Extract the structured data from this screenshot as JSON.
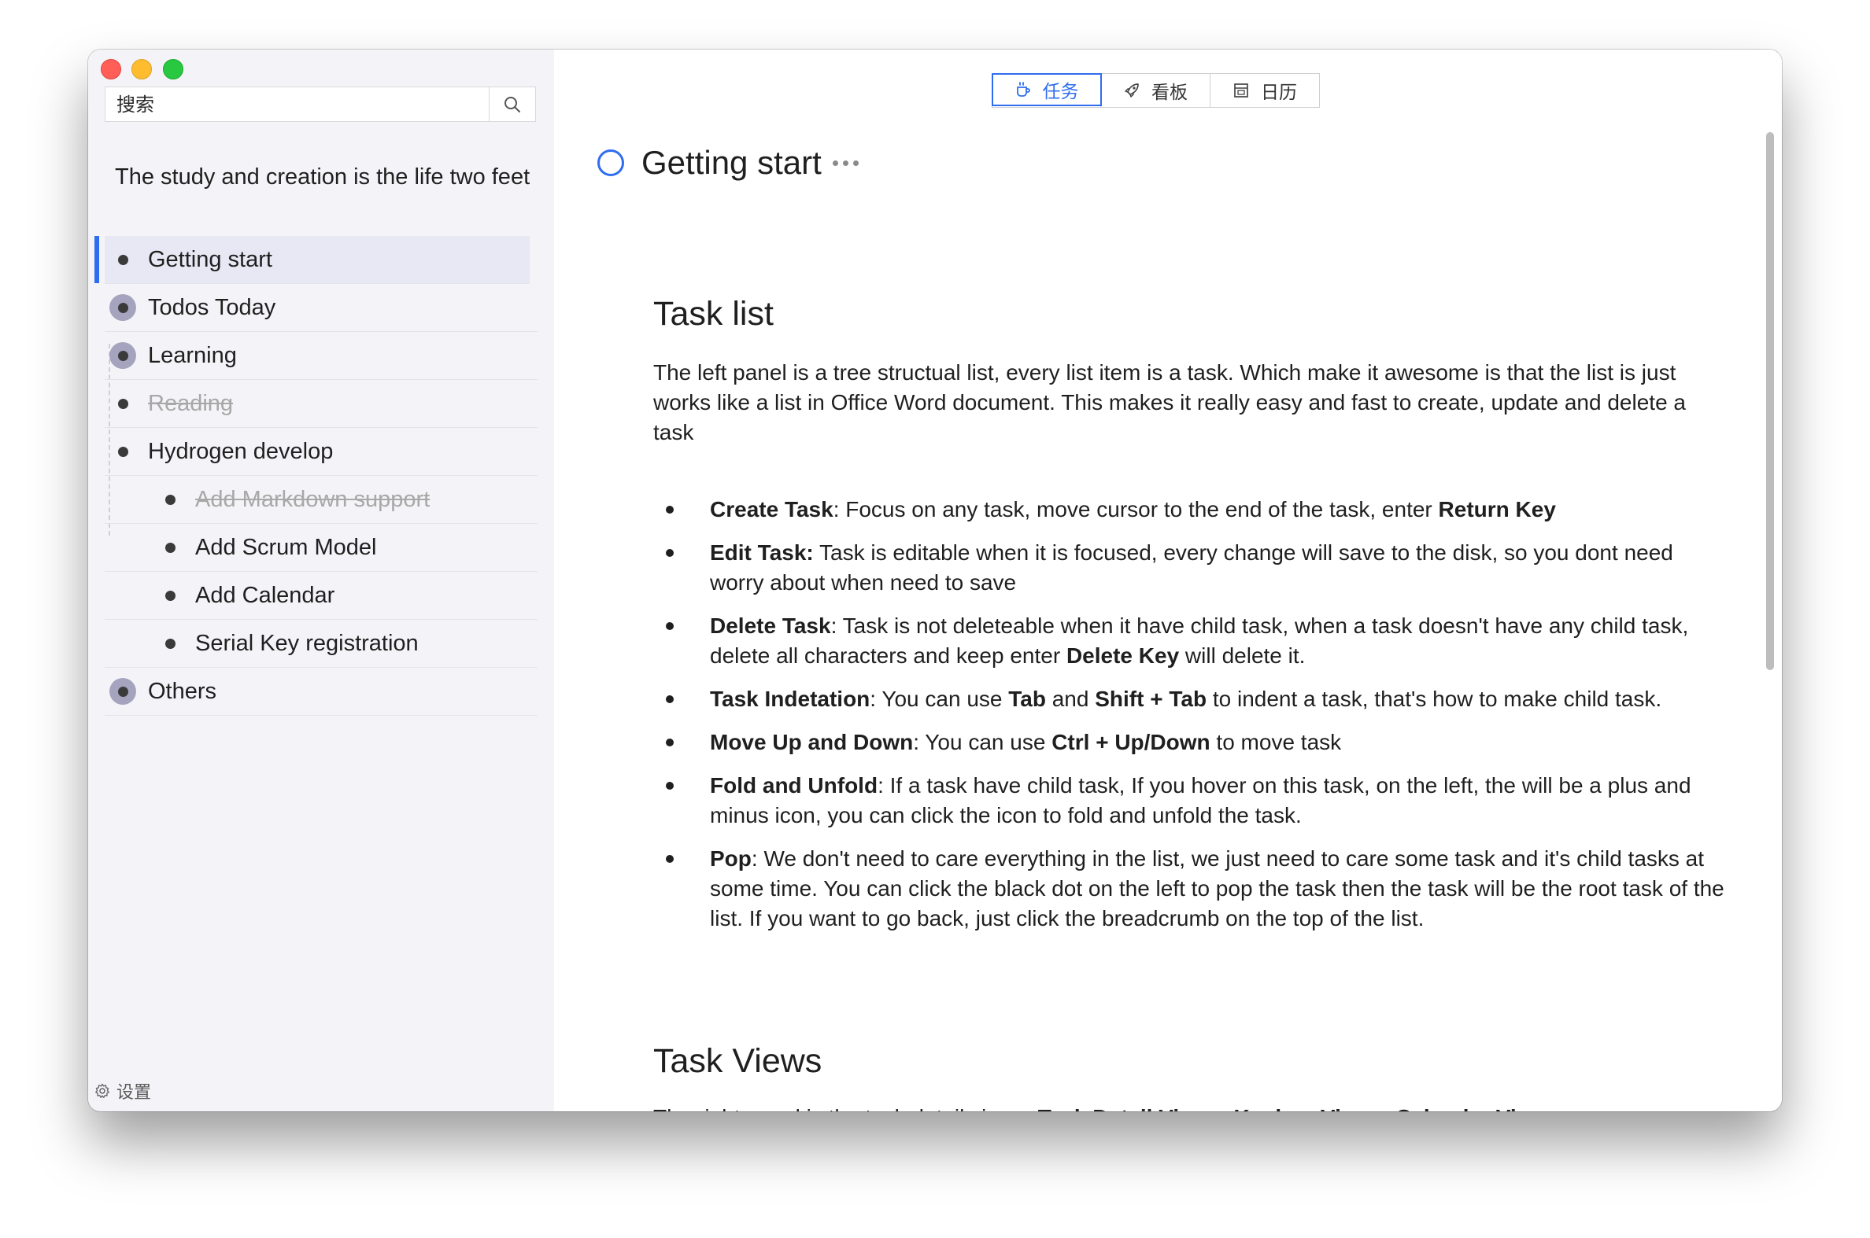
{
  "sidebar": {
    "search_placeholder": "搜索",
    "root_title": "The study and creation is the life two feet",
    "items": [
      {
        "label": "Getting start",
        "selected": true,
        "has_children": false,
        "done": false,
        "child": false
      },
      {
        "label": "Todos Today",
        "selected": false,
        "has_children": true,
        "done": false,
        "child": false
      },
      {
        "label": "Learning",
        "selected": false,
        "has_children": true,
        "done": false,
        "child": false
      },
      {
        "label": "Reading",
        "selected": false,
        "has_children": false,
        "done": true,
        "child": false
      },
      {
        "label": "Hydrogen develop",
        "selected": false,
        "has_children": false,
        "done": false,
        "child": false
      },
      {
        "label": "Add Markdown support",
        "selected": false,
        "has_children": false,
        "done": true,
        "child": true
      },
      {
        "label": "Add Scrum Model",
        "selected": false,
        "has_children": false,
        "done": false,
        "child": true
      },
      {
        "label": "Add Calendar",
        "selected": false,
        "has_children": false,
        "done": false,
        "child": true
      },
      {
        "label": "Serial Key registration",
        "selected": false,
        "has_children": false,
        "done": false,
        "child": true
      },
      {
        "label": "Others",
        "selected": false,
        "has_children": true,
        "done": false,
        "child": false
      }
    ],
    "settings_label": "设置"
  },
  "main": {
    "tabs": [
      {
        "label": "任务",
        "icon": "coffee-cup-icon",
        "active": true
      },
      {
        "label": "看板",
        "icon": "rocket-icon",
        "active": false
      },
      {
        "label": "日历",
        "icon": "calendar-icon",
        "active": false
      }
    ],
    "task_title": "Getting start",
    "section1": {
      "heading": "Task list",
      "description": "The left panel is a tree structual list, every list item is a task. Which make it awesome is that the list is just works like a list in Office Word document. This makes it really easy and fast to create, update and delete a task",
      "features": [
        {
          "term": "Create Task",
          "sep": ":  ",
          "text": "Focus on any task, move cursor to the end of the task, enter ",
          "key1": "Return Key",
          "text2": "",
          "key2": "",
          "text3": ""
        },
        {
          "term": "Edit Task:",
          "sep": " ",
          "text": "Task is editable when it is focused, every change will save to the disk, so you dont need worry about when need to save",
          "key1": "",
          "text2": "",
          "key2": "",
          "text3": ""
        },
        {
          "term": "Delete Task",
          "sep": ": ",
          "text": "Task is not deleteable when it have child task, when a task doesn't have any child task, delete all characters and keep enter ",
          "key1": "Delete Key",
          "text2": " will delete it.",
          "key2": "",
          "text3": ""
        },
        {
          "term": "Task Indetation",
          "sep": ": ",
          "text": "You can use ",
          "key1": "Tab",
          "text2": " and ",
          "key2": "Shift + Tab",
          "text3": " to indent a task, that's how to make child task."
        },
        {
          "term": "Move Up and Down",
          "sep": ": ",
          "text": "You can use ",
          "key1": "Ctrl + Up/Down",
          "text2": " to move task",
          "key2": "",
          "text3": ""
        },
        {
          "term": "Fold and Unfold",
          "sep": ": ",
          "text": "If a task have child task, If you hover on this task, on the left, the will be a plus and minus icon, you can click the icon to fold and unfold the task.",
          "key1": "",
          "text2": "",
          "key2": "",
          "text3": ""
        },
        {
          "term": "Pop",
          "sep": ": ",
          "text": "We don't need to care everything in the list, we just need to care some task and it's child tasks at some time. You can click the black dot on the left to pop the task then the task will be the root task of the list. If you want to go back, just click the breadcrumb on the top of the list.",
          "key1": "",
          "text2": "",
          "key2": "",
          "text3": ""
        }
      ]
    },
    "section2": {
      "heading": "Task Views",
      "description_prefix": "The right panel is the task detail views: ",
      "description_bold": "Task Detail View + Kanban View + Calendar View"
    }
  },
  "colors": {
    "accent": "#2f6df0",
    "sidebar_bg": "#f4f4f8",
    "selected_bg": "#e8e8f4",
    "parent_bullet_bg": "#a4a4bf",
    "done_text": "#a8a8a8"
  }
}
